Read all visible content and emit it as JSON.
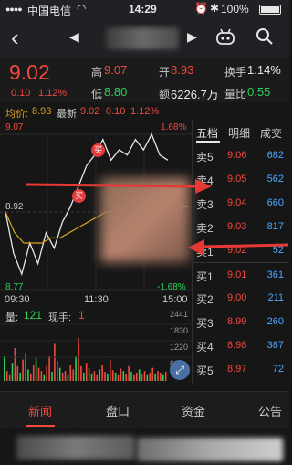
{
  "status_bar": {
    "carrier": "中国电信",
    "time": "14:29",
    "battery": "100%"
  },
  "quote": {
    "price": "9.02",
    "change": "0.10",
    "change_pct": "1.12%",
    "high_label": "高",
    "high": "9.07",
    "open_label": "开",
    "open": "8.93",
    "turnover_label": "换手",
    "turnover": "1.14%",
    "low_label": "低",
    "low": "8.80",
    "amount_label": "额",
    "amount": "6226.7万",
    "volume_ratio_label": "量比",
    "volume_ratio": "0.55"
  },
  "chart_info": {
    "avg_label": "均价:",
    "avg": "8.93",
    "latest_label": "最新:",
    "latest": "9.02",
    "change": "0.10",
    "change_pct": "1.12%"
  },
  "chart": {
    "price_max": "9.07",
    "pct_max": "1.68%",
    "price_mid": "8.92",
    "price_min": "8.77",
    "pct_min": "-1.68%",
    "time_start": "09:30",
    "time_mid": "11:30",
    "time_end": "15:00",
    "trade_marker": "买",
    "volume_label": "量:",
    "volume": "121",
    "hand_label": "现手:",
    "hand": "1",
    "vol_ticks": [
      "2441",
      "1830",
      "1220",
      "610"
    ]
  },
  "chart_data": {
    "type": "line",
    "title": "",
    "x": [
      "09:30",
      "11:30",
      "15:00"
    ],
    "ylim": [
      8.77,
      9.07
    ],
    "series": [
      {
        "values": [
          8.92,
          8.84,
          8.8,
          8.86,
          8.82,
          8.88,
          8.85,
          8.9,
          8.93,
          8.97,
          9.01,
          9.03,
          9.06,
          9.02,
          9.04,
          9.03,
          9.06,
          9.04,
          9.07,
          9.03,
          9.02
        ]
      },
      {
        "values": [
          8.92,
          8.88,
          8.86,
          8.86,
          8.86,
          8.87,
          8.87,
          8.88,
          8.89,
          8.9,
          8.91,
          8.92,
          8.92,
          8.93,
          8.93,
          8.93,
          8.93,
          8.93,
          8.93,
          8.93,
          8.93
        ]
      }
    ]
  },
  "orderbook": {
    "tabs": [
      "五档",
      "明细",
      "成交"
    ],
    "asks": [
      {
        "label": "卖5",
        "price": "9.06",
        "vol": "682"
      },
      {
        "label": "卖4",
        "price": "9.05",
        "vol": "562"
      },
      {
        "label": "卖3",
        "price": "9.04",
        "vol": "660"
      },
      {
        "label": "卖2",
        "price": "9.03",
        "vol": "817"
      },
      {
        "label": "卖1",
        "price": "9.02",
        "vol": "52"
      }
    ],
    "bids": [
      {
        "label": "买1",
        "price": "9.01",
        "vol": "361"
      },
      {
        "label": "买2",
        "price": "9.00",
        "vol": "211"
      },
      {
        "label": "买3",
        "price": "8.99",
        "vol": "260"
      },
      {
        "label": "买4",
        "price": "8.98",
        "vol": "387"
      },
      {
        "label": "买5",
        "price": "8.97",
        "vol": "72"
      }
    ]
  },
  "bottom_tabs": [
    "新闻",
    "盘口",
    "资金",
    "公告"
  ],
  "colors": {
    "up": "#f0493e",
    "down": "#2bd15a",
    "accent_blue": "#4da6ff",
    "avg_line": "#d9a320"
  }
}
